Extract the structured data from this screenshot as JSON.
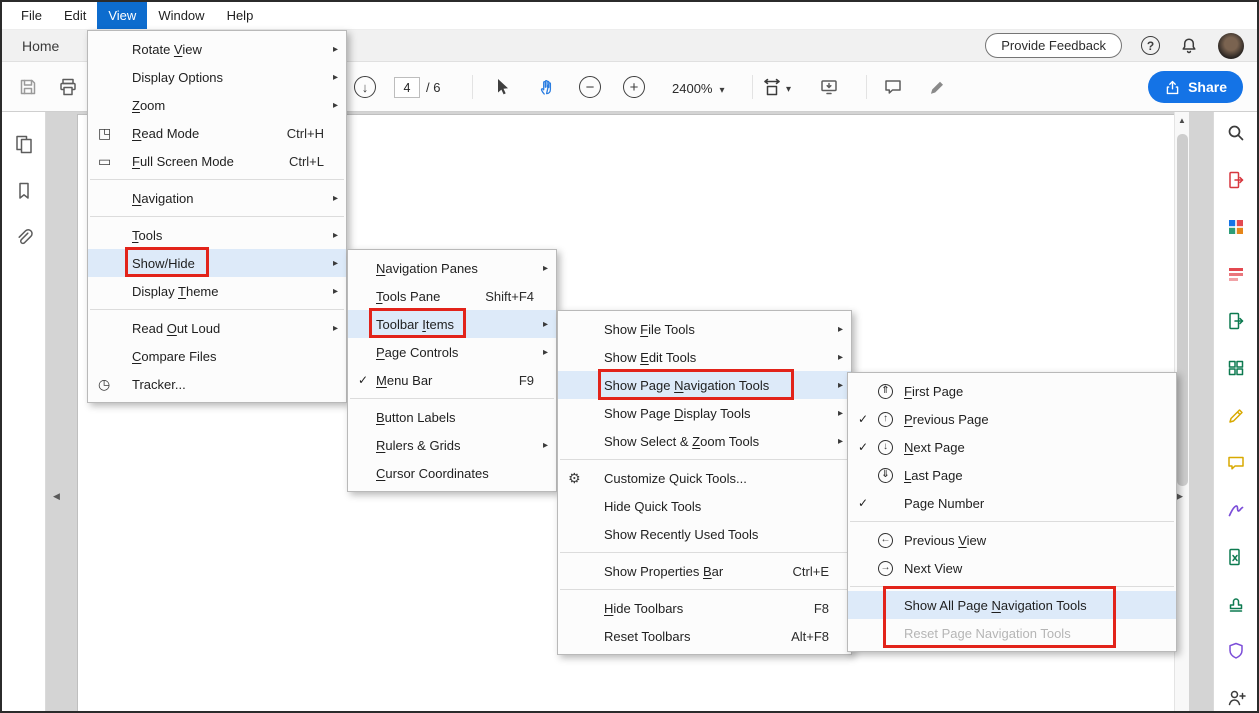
{
  "colors": {
    "accent_blue": "#1473e6",
    "menubar_active_bg": "#0d6cce",
    "menu_highlight": "#ddeaf9",
    "callout_red": "#e2231a",
    "hand_tool_blue": "#2a7de1"
  },
  "menubar": {
    "items": [
      {
        "label": "File"
      },
      {
        "label": "Edit"
      },
      {
        "label": "View",
        "active": true
      },
      {
        "label": "Window"
      },
      {
        "label": "Help"
      }
    ]
  },
  "tabbar": {
    "home_label": "Home",
    "feedback_button": "Provide Feedback",
    "right_icons": [
      "help",
      "bell",
      "avatar"
    ]
  },
  "toolbar": {
    "page_field_value": "4",
    "page_total_label": "/ 6",
    "zoom_value": "2400%",
    "share_button": "Share",
    "icons": [
      "save",
      "print",
      "next-page-circle",
      "page-number-input",
      "select-tool",
      "hand-tool",
      "zoom-out",
      "zoom-in",
      "zoom-level-dropdown",
      "fit-width-dropdown",
      "page-display",
      "comment",
      "highlight",
      "share"
    ]
  },
  "left_rail": {
    "icons": [
      "page-thumbnails",
      "bookmarks",
      "attachments"
    ]
  },
  "right_rail": {
    "icons": [
      "search",
      "export-pdf",
      "create-pdf",
      "organize-pages",
      "send-file",
      "convert-grid",
      "edit-pdf",
      "comment",
      "fill-sign",
      "convert-excel",
      "stamp",
      "protect",
      "more-tools"
    ]
  },
  "document": {
    "page_background": "blank white page",
    "scrollbar": {
      "up_arrow": true,
      "thumb": true
    }
  },
  "callouts": {
    "color": "#e2231a",
    "targets": [
      "Show/Hide",
      "Toolbar Items",
      "Show Page Navigation Tools",
      "Show All Page Navigation Tools / Reset Page Navigation Tools"
    ]
  },
  "glyphs": {
    "read-mode": "◳",
    "full-screen": "▭",
    "tracker": "◷",
    "gear": "⚙",
    "first-page": "⇑",
    "prev-page": "↑",
    "next-page": "↓",
    "last-page": "⇓",
    "prev-view": "←",
    "next-view": "→",
    "check": "✓",
    "submenu-arrow": "▸"
  },
  "menus": {
    "view": {
      "items": [
        {
          "label": "Rotate View",
          "u": "V",
          "submenu": true
        },
        {
          "label": "Display Options",
          "submenu": true
        },
        {
          "label": "Zoom",
          "u": "Z",
          "submenu": true
        },
        {
          "label": "Read Mode",
          "u": "R",
          "icon": "read-mode",
          "shortcut": "Ctrl+H"
        },
        {
          "label": "Full Screen Mode",
          "u": "F",
          "icon": "full-screen",
          "shortcut": "Ctrl+L"
        },
        {
          "separator": true
        },
        {
          "label": "Navigation",
          "u": "N",
          "submenu": true
        },
        {
          "separator": true
        },
        {
          "label": "Tools",
          "u": "T",
          "submenu": true
        },
        {
          "label": "Show/Hide",
          "submenu": true,
          "highlighted": true
        },
        {
          "label": "Display Theme",
          "u": "T",
          "submenu": true
        },
        {
          "separator": true
        },
        {
          "label": "Read Out Loud",
          "u": "O",
          "submenu": true
        },
        {
          "label": "Compare Files",
          "u": "C"
        },
        {
          "label": "Tracker...",
          "icon": "tracker"
        }
      ]
    },
    "show_hide": {
      "items": [
        {
          "label": "Navigation Panes",
          "u": "N",
          "submenu": true
        },
        {
          "label": "Tools Pane",
          "u": "T",
          "shortcut": "Shift+F4"
        },
        {
          "label": "Toolbar Items",
          "u": "I",
          "submenu": true,
          "highlighted": true
        },
        {
          "label": "Page Controls",
          "u": "P",
          "submenu": true
        },
        {
          "label": "Menu Bar",
          "u": "M",
          "check": true,
          "shortcut": "F9"
        },
        {
          "separator": true
        },
        {
          "label": "Button Labels",
          "u": "B"
        },
        {
          "label": "Rulers & Grids",
          "u": "R",
          "submenu": true
        },
        {
          "label": "Cursor Coordinates",
          "u": "C"
        }
      ]
    },
    "toolbar_items": {
      "items": [
        {
          "label": "Show File Tools",
          "u": "F",
          "submenu": true
        },
        {
          "label": "Show Edit Tools",
          "u": "E",
          "submenu": true
        },
        {
          "label": "Show Page Navigation Tools",
          "u": "N",
          "submenu": true,
          "highlighted": true
        },
        {
          "label": "Show Page Display Tools",
          "u": "D",
          "submenu": true
        },
        {
          "label": "Show Select & Zoom Tools",
          "u": "Z",
          "submenu": true
        },
        {
          "separator": true
        },
        {
          "label": "Customize Quick Tools...",
          "icon": "gear"
        },
        {
          "label": "Hide Quick Tools"
        },
        {
          "label": "Show Recently Used Tools"
        },
        {
          "separator": true
        },
        {
          "label": "Show Properties Bar",
          "u": "B",
          "shortcut": "Ctrl+E"
        },
        {
          "separator": true
        },
        {
          "label": "Hide Toolbars",
          "u": "H",
          "shortcut": "F8"
        },
        {
          "label": "Reset Toolbars",
          "shortcut": "Alt+F8"
        }
      ]
    },
    "page_navigation": {
      "items": [
        {
          "label": "First Page",
          "u": "F",
          "icon": "first-page"
        },
        {
          "label": "Previous Page",
          "u": "P",
          "icon": "prev-page",
          "check": true
        },
        {
          "label": "Next Page",
          "u": "N",
          "icon": "next-page",
          "check": true
        },
        {
          "label": "Last Page",
          "u": "L",
          "icon": "last-page"
        },
        {
          "label": "Page Number",
          "check": true
        },
        {
          "separator": true
        },
        {
          "label": "Previous View",
          "u": "V",
          "icon": "prev-view"
        },
        {
          "label": "Next View",
          "icon": "next-view"
        },
        {
          "separator": true
        },
        {
          "label": "Show All Page Navigation Tools",
          "u": "N",
          "highlighted": true
        },
        {
          "label": "Reset Page Navigation Tools",
          "disabled": true
        }
      ]
    }
  }
}
